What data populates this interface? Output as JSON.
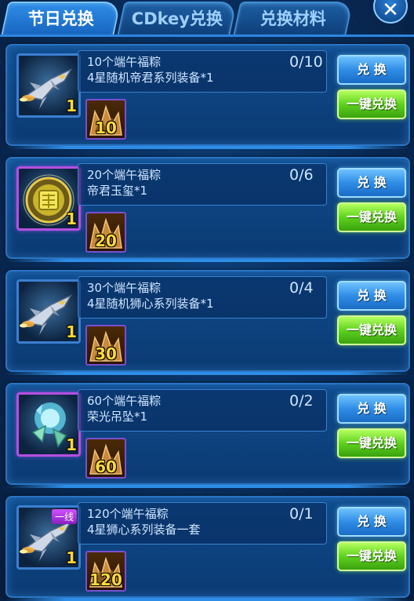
{
  "tabs": [
    {
      "label": "节日兑换",
      "active": true
    },
    {
      "label": "CDkey兑换",
      "active": false
    },
    {
      "label": "兑换材料",
      "active": false
    }
  ],
  "close_icon": "close-icon",
  "colors": {
    "accent_blue": "#2f8de6",
    "accent_green": "#5ed21e",
    "count_yellow": "#ffd83a",
    "frame_purple": "#b64fe0"
  },
  "exchange_items": [
    {
      "requirement": "10个端午福粽",
      "reward": "4星随机帝君系列装备*1",
      "progress": "0/10",
      "item_count": "1",
      "cost": "10",
      "item_icon": "fighter-jet-icon",
      "frame": "blue",
      "tag": ""
    },
    {
      "requirement": "20个端午福粽",
      "reward": "帝君玉玺*1",
      "progress": "0/6",
      "item_count": "1",
      "cost": "20",
      "item_icon": "jade-seal-icon",
      "frame": "purple",
      "tag": ""
    },
    {
      "requirement": "30个端午福粽",
      "reward": "4星随机狮心系列装备*1",
      "progress": "0/4",
      "item_count": "1",
      "cost": "30",
      "item_icon": "fighter-jet-icon",
      "frame": "blue",
      "tag": ""
    },
    {
      "requirement": "60个端午福粽",
      "reward": "荣光吊坠*1",
      "progress": "0/2",
      "item_count": "1",
      "cost": "60",
      "item_icon": "glory-pendant-icon",
      "frame": "purple",
      "tag": ""
    },
    {
      "requirement": "120个端午福粽",
      "reward": "4星狮心系列装备一套",
      "progress": "0/1",
      "item_count": "1",
      "cost": "120",
      "item_icon": "fighter-jet-icon",
      "frame": "blue",
      "tag": "一线"
    }
  ],
  "buttons": {
    "exchange": "兑 换",
    "one_click": "一键兑换"
  }
}
